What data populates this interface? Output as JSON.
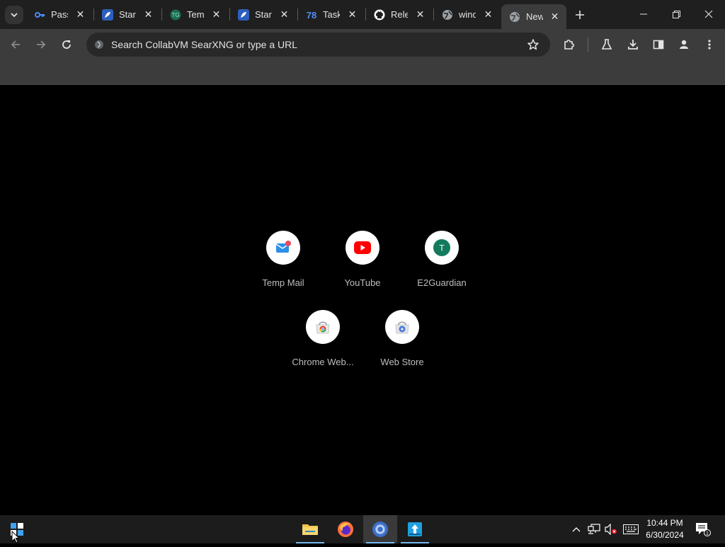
{
  "browser": {
    "tabs": [
      {
        "title": "Pass",
        "icon": "key-icon",
        "color": "#4c8df6"
      },
      {
        "title": "Start",
        "icon": "starship-icon",
        "color": "#3f7ae0"
      },
      {
        "title": "Temp",
        "icon": "temp-mail-icon",
        "color": "#1aa27d"
      },
      {
        "title": "Start",
        "icon": "starship-icon",
        "color": "#3f7ae0"
      },
      {
        "title": "Task",
        "icon": "taskade-icon",
        "color": "#3b82f6"
      },
      {
        "title": "Rele",
        "icon": "github-icon",
        "color": "#ffffff"
      },
      {
        "title": "wind",
        "icon": "globe-icon",
        "color": "#bdbdbd"
      },
      {
        "title": "New",
        "icon": "globe-icon",
        "color": "#bdbdbd",
        "active": true
      }
    ],
    "omnibox_placeholder": "Search CollabVM SearXNG or type a URL"
  },
  "new_tab": {
    "shortcuts": [
      {
        "label": "Temp Mail",
        "icon": "temp-mail-icon"
      },
      {
        "label": "YouTube",
        "icon": "youtube-icon"
      },
      {
        "label": "E2Guardian",
        "icon": "letter-t-icon",
        "letter": "T"
      },
      {
        "label": "Chrome Web...",
        "icon": "chrome-web-store-icon"
      },
      {
        "label": "Web Store",
        "icon": "web-store-icon"
      }
    ]
  },
  "taskbar": {
    "apps": [
      "file-explorer-icon",
      "firefox-icon",
      "chrome-icon",
      "app-icon"
    ],
    "time": "10:44 PM",
    "date": "6/30/2024",
    "notification_count": "1"
  },
  "colors": {
    "accent": "#76b9ed",
    "tab_bg": "#1f1f1f",
    "toolbar_bg": "#3c3c3c"
  }
}
